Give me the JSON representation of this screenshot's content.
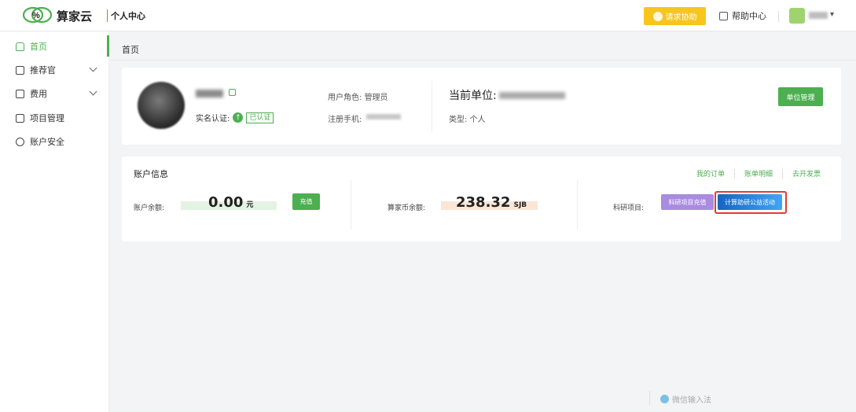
{
  "colors": {
    "accent": "#4caf50",
    "help": "#f7c51e",
    "highlight": "#e53935",
    "purple": "#a98be0",
    "blue": "#1e88e5"
  },
  "header": {
    "brand": "算家云",
    "subtitle": "个人中心",
    "help_label": "请求协助",
    "help_center": "帮助中心",
    "user_menu": "▾"
  },
  "sidebar": {
    "items": [
      {
        "label": "首页",
        "icon": "home-icon",
        "active": true
      },
      {
        "label": "推荐官",
        "icon": "document-icon",
        "expandable": true
      },
      {
        "label": "费用",
        "icon": "wallet-icon",
        "expandable": true
      },
      {
        "label": "项目管理",
        "icon": "folder-icon"
      },
      {
        "label": "账户安全",
        "icon": "shield-icon"
      }
    ]
  },
  "breadcrumb": "首页",
  "profile": {
    "real_name_label": "实名认证:",
    "verified_badge": "已认证",
    "role_label": "用户角色:",
    "role_value": "管理员",
    "phone_label": "注册手机:",
    "unit_label": "当前单位:",
    "type_label": "类型:",
    "type_value": "个人",
    "unit_btn": "单位管理"
  },
  "account": {
    "title": "账户信息",
    "links": [
      "我的订单",
      "账单明细",
      "去开发票"
    ],
    "balance_label": "账户余额:",
    "balance_value": "0.00",
    "balance_unit": "元",
    "recharge": "充值",
    "coin_label": "算家币余额:",
    "coin_value": "238.32",
    "coin_unit": "SJB",
    "research_label": "科研项目:",
    "research_btn1": "科研项目充值",
    "research_btn2": "计算助研公益活动"
  },
  "ime": "微信输入法"
}
